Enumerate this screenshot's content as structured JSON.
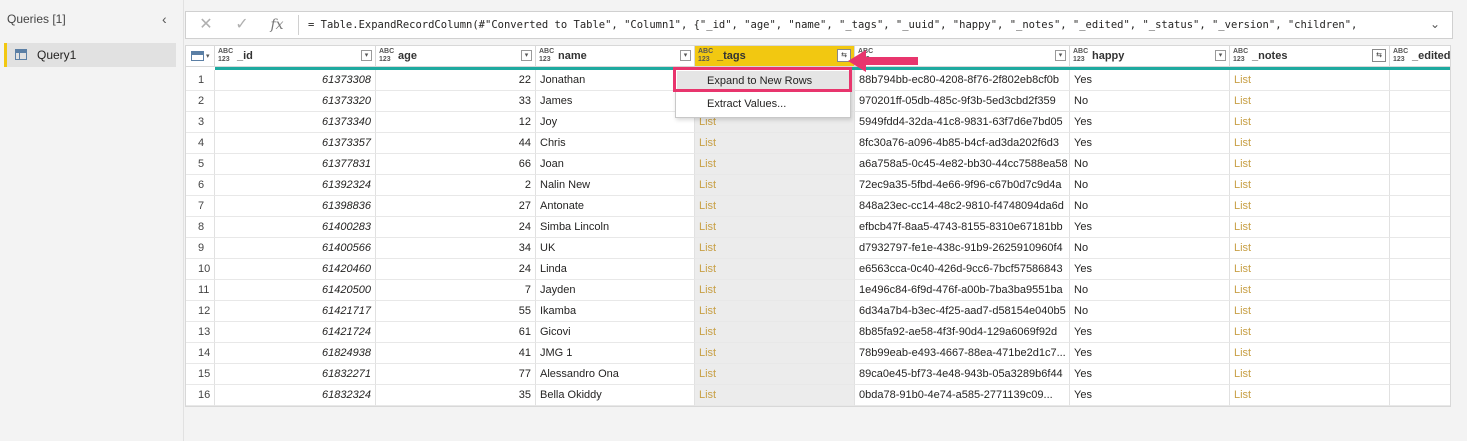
{
  "queries": {
    "header": "Queries [1]",
    "items": [
      {
        "label": "Query1"
      }
    ]
  },
  "formula": {
    "cancel_icon": "✕",
    "commit_icon": "✓",
    "fx": "fx",
    "text": "= Table.ExpandRecordColumn(#\"Converted to Table\", \"Column1\", {\"_id\", \"age\", \"name\", \"_tags\", \"_uuid\", \"happy\", \"_notes\", \"_edited\", \"_status\", \"_version\", \"children\","
  },
  "type_icon_text": {
    "top": "ABC",
    "bottom": "123"
  },
  "columns": [
    {
      "name": "_id"
    },
    {
      "name": "age"
    },
    {
      "name": "name"
    },
    {
      "name": "_tags"
    },
    {
      "name": ""
    },
    {
      "name": "happy"
    },
    {
      "name": "_notes"
    },
    {
      "name": "_edited"
    }
  ],
  "context_menu": {
    "items": [
      "Expand to New Rows",
      "Extract Values..."
    ]
  },
  "list_label": "List",
  "rows": [
    {
      "n": "1",
      "id": "61373308",
      "age": "22",
      "name": "Jonathan",
      "uuid": "88b794bb-ec80-4208-8f76-2f802eb8cf0b",
      "happy": "Yes"
    },
    {
      "n": "2",
      "id": "61373320",
      "age": "33",
      "name": "James",
      "uuid": "970201ff-05db-485c-9f3b-5ed3cbd2f359",
      "happy": "No"
    },
    {
      "n": "3",
      "id": "61373340",
      "age": "12",
      "name": "Joy",
      "uuid": "5949fdd4-32da-41c8-9831-63f7d6e7bd05",
      "happy": "Yes"
    },
    {
      "n": "4",
      "id": "61373357",
      "age": "44",
      "name": "Chris",
      "uuid": "8fc30a76-a096-4b85-b4cf-ad3da202f6d3",
      "happy": "Yes"
    },
    {
      "n": "5",
      "id": "61377831",
      "age": "66",
      "name": "Joan",
      "uuid": "a6a758a5-0c45-4e82-bb30-44cc7588ea58",
      "happy": "No"
    },
    {
      "n": "6",
      "id": "61392324",
      "age": "2",
      "name": "Nalin New",
      "uuid": "72ec9a35-5fbd-4e66-9f96-c67b0d7c9d4a",
      "happy": "No"
    },
    {
      "n": "7",
      "id": "61398836",
      "age": "27",
      "name": "Antonate",
      "uuid": "848a23ec-cc14-48c2-9810-f4748094da6d",
      "happy": "No"
    },
    {
      "n": "8",
      "id": "61400283",
      "age": "24",
      "name": "Simba Lincoln",
      "uuid": "efbcb47f-8aa5-4743-8155-8310e67181bb",
      "happy": "Yes"
    },
    {
      "n": "9",
      "id": "61400566",
      "age": "34",
      "name": "UK",
      "uuid": "d7932797-fe1e-438c-91b9-2625910960f4",
      "happy": "No"
    },
    {
      "n": "10",
      "id": "61420460",
      "age": "24",
      "name": "Linda",
      "uuid": "e6563cca-0c40-426d-9cc6-7bcf57586843",
      "happy": "Yes"
    },
    {
      "n": "11",
      "id": "61420500",
      "age": "7",
      "name": "Jayden",
      "uuid": "1e496c84-6f9d-476f-a00b-7ba3ba9551ba",
      "happy": "No"
    },
    {
      "n": "12",
      "id": "61421717",
      "age": "55",
      "name": "Ikamba",
      "uuid": "6d34a7b4-b3ec-4f25-aad7-d58154e040b5",
      "happy": "No"
    },
    {
      "n": "13",
      "id": "61421724",
      "age": "61",
      "name": "Gicovi",
      "uuid": "8b85fa92-ae58-4f3f-90d4-129a6069f92d",
      "happy": "Yes"
    },
    {
      "n": "14",
      "id": "61824938",
      "age": "41",
      "name": "JMG 1",
      "uuid": "78b99eab-e493-4667-88ea-471be2d1c7...",
      "happy": "Yes"
    },
    {
      "n": "15",
      "id": "61832271",
      "age": "77",
      "name": "Alessandro Ona",
      "uuid": "89ca0e45-bf73-4e48-943b-05a3289b6f44",
      "happy": "Yes"
    },
    {
      "n": "16",
      "id": "61832324",
      "age": "35",
      "name": "Bella Okiddy",
      "uuid": "0bda78-91b0-4e74-a585-2771139c09...",
      "happy": "Yes"
    }
  ],
  "colors": {
    "accent": "#f2c811",
    "quality": "#1eaaa0",
    "highlight": "#e8356d",
    "list": "#c8a046"
  }
}
